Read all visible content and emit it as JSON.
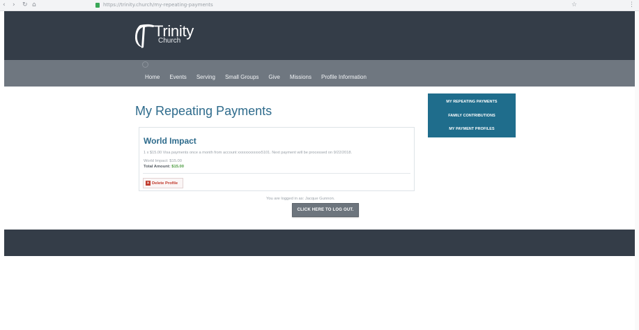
{
  "browser": {
    "url": "https://trinity.church/my-repeating-payments",
    "back": "‹",
    "forward": "›",
    "reload": "↻",
    "home": "⌂",
    "menu": "⋮",
    "extensions": "☆"
  },
  "header": {
    "logo_name": "Trinity",
    "logo_sub": "Church",
    "logo_icon": "trinity-logo-icon"
  },
  "nav": {
    "items": [
      "Home",
      "Events",
      "Serving",
      "Small Groups",
      "Give",
      "Missions",
      "Profile Information"
    ]
  },
  "main": {
    "title": "My Repeating Payments",
    "card": {
      "title": "World Impact",
      "description": "1 x $15.00 Visa payments once a month from account xxxxxxxxxxxx5101. Next payment will be processed on 9/22/2018.",
      "fund_line": "World Impact: $15.00",
      "total_label": "Total Amount:",
      "total_value": "$15.00",
      "delete_label": "Delete Profile"
    },
    "logged_in_text": "You are logged in as: Jacque Gunnon.",
    "logout_label": "CLICK HERE TO LOG OUT."
  },
  "side_menu": {
    "items": [
      "MY REPEATING PAYMENTS",
      "FAMILY CONTRIBUTIONS",
      "MY PAYMENT PROFILES"
    ]
  },
  "colors": {
    "header_bg": "#343d48",
    "nav_bg": "#6f7780",
    "accent": "#2e6b8c",
    "side_menu_bg": "#1f6d8c",
    "delete": "#c0392b",
    "amount_green": "#4a9a3f"
  }
}
